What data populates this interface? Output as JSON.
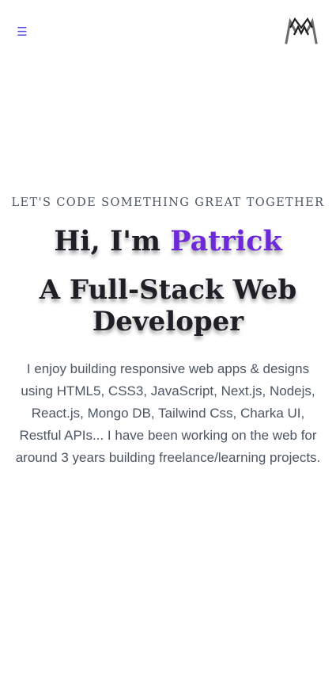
{
  "nav": {
    "menu_icon": "hamburger-menu-icon",
    "menu_glyph": "☰",
    "logo_icon": "brand-logo-icon"
  },
  "hero": {
    "tagline": "LET'S CODE SOMETHING GREAT TOGETHER",
    "greeting_prefix": "Hi, I'm ",
    "greeting_name": "Patrick",
    "role_line1": "A Full-Stack Web",
    "role_line2": "Developer",
    "bio_lines": [
      "I enjoy building responsive web apps & designs",
      "using HTML5, CSS3, JavaScript, Next.js, Nodejs,",
      "React.js, Mongo DB, Tailwind Css, Charka UI,",
      "Restful APIs... I have been working on the web for",
      "around 3 years building freelance/learning projects."
    ]
  },
  "colors": {
    "accent": "#6d28d9",
    "menu_icon": "#4f46e5",
    "heading": "#1f1f26",
    "body_text": "#4b5563"
  }
}
